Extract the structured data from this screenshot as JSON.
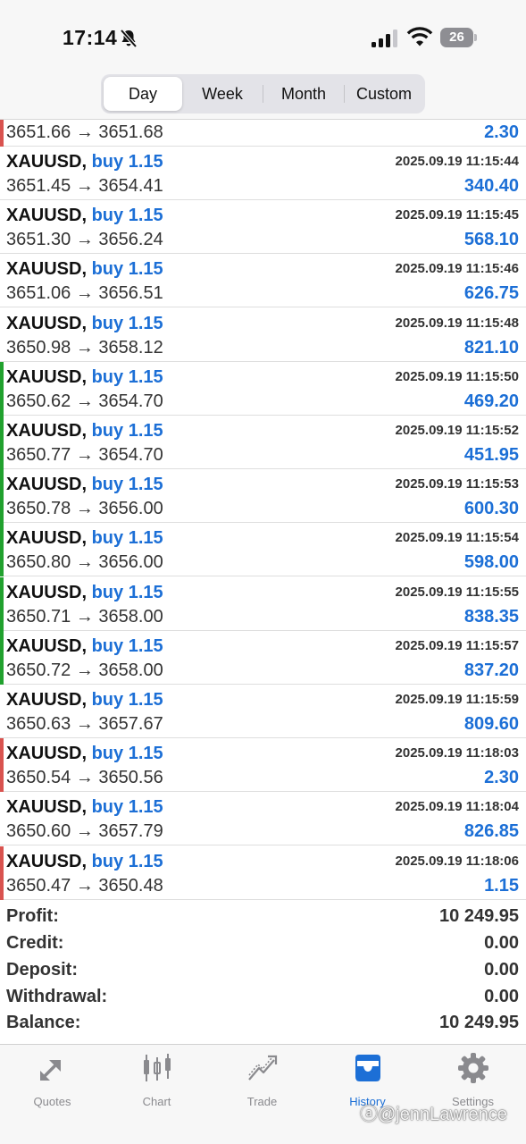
{
  "status_bar": {
    "time": "17:14",
    "battery": "26"
  },
  "segments": [
    {
      "label": "Day",
      "active": true
    },
    {
      "label": "Week",
      "active": false
    },
    {
      "label": "Month",
      "active": false
    },
    {
      "label": "Custom",
      "active": false
    }
  ],
  "partial_deal": {
    "prices": "3651.66 → 3651.68",
    "profit": "2.30",
    "marker": "red"
  },
  "deals": [
    {
      "symbol": "XAUUSD,",
      "type": "buy 1.15",
      "time": "2025.09.19 11:15:44",
      "prices": "3651.45 → 3654.41",
      "profit": "340.40",
      "marker": "none"
    },
    {
      "symbol": "XAUUSD,",
      "type": "buy 1.15",
      "time": "2025.09.19 11:15:45",
      "prices": "3651.30 → 3656.24",
      "profit": "568.10",
      "marker": "none"
    },
    {
      "symbol": "XAUUSD,",
      "type": "buy 1.15",
      "time": "2025.09.19 11:15:46",
      "prices": "3651.06 → 3656.51",
      "profit": "626.75",
      "marker": "none"
    },
    {
      "symbol": "XAUUSD,",
      "type": "buy 1.15",
      "time": "2025.09.19 11:15:48",
      "prices": "3650.98 → 3658.12",
      "profit": "821.10",
      "marker": "none"
    },
    {
      "symbol": "XAUUSD,",
      "type": "buy 1.15",
      "time": "2025.09.19 11:15:50",
      "prices": "3650.62 → 3654.70",
      "profit": "469.20",
      "marker": "green"
    },
    {
      "symbol": "XAUUSD,",
      "type": "buy 1.15",
      "time": "2025.09.19 11:15:52",
      "prices": "3650.77 → 3654.70",
      "profit": "451.95",
      "marker": "green"
    },
    {
      "symbol": "XAUUSD,",
      "type": "buy 1.15",
      "time": "2025.09.19 11:15:53",
      "prices": "3650.78 → 3656.00",
      "profit": "600.30",
      "marker": "green"
    },
    {
      "symbol": "XAUUSD,",
      "type": "buy 1.15",
      "time": "2025.09.19 11:15:54",
      "prices": "3650.80 → 3656.00",
      "profit": "598.00",
      "marker": "green"
    },
    {
      "symbol": "XAUUSD,",
      "type": "buy 1.15",
      "time": "2025.09.19 11:15:55",
      "prices": "3650.71 → 3658.00",
      "profit": "838.35",
      "marker": "green"
    },
    {
      "symbol": "XAUUSD,",
      "type": "buy 1.15",
      "time": "2025.09.19 11:15:57",
      "prices": "3650.72 → 3658.00",
      "profit": "837.20",
      "marker": "green"
    },
    {
      "symbol": "XAUUSD,",
      "type": "buy 1.15",
      "time": "2025.09.19 11:15:59",
      "prices": "3650.63 → 3657.67",
      "profit": "809.60",
      "marker": "none"
    },
    {
      "symbol": "XAUUSD,",
      "type": "buy 1.15",
      "time": "2025.09.19 11:18:03",
      "prices": "3650.54 → 3650.56",
      "profit": "2.30",
      "marker": "red"
    },
    {
      "symbol": "XAUUSD,",
      "type": "buy 1.15",
      "time": "2025.09.19 11:18:04",
      "prices": "3650.60 → 3657.79",
      "profit": "826.85",
      "marker": "none"
    },
    {
      "symbol": "XAUUSD,",
      "type": "buy 1.15",
      "time": "2025.09.19 11:18:06",
      "prices": "3650.47 → 3650.48",
      "profit": "1.15",
      "marker": "red"
    }
  ],
  "summary": [
    {
      "label": "Profit:",
      "value": "10 249.95"
    },
    {
      "label": "Credit:",
      "value": "0.00"
    },
    {
      "label": "Deposit:",
      "value": "0.00"
    },
    {
      "label": "Withdrawal:",
      "value": "0.00"
    },
    {
      "label": "Balance:",
      "value": "10 249.95"
    }
  ],
  "tabs": [
    {
      "label": "Quotes",
      "icon": "quotes-icon",
      "active": false
    },
    {
      "label": "Chart",
      "icon": "chart-icon",
      "active": false
    },
    {
      "label": "Trade",
      "icon": "trade-icon",
      "active": false
    },
    {
      "label": "History",
      "icon": "history-icon",
      "active": true
    },
    {
      "label": "Settings",
      "icon": "settings-icon",
      "active": false
    }
  ],
  "watermark": "@jennLawrence",
  "colors": {
    "accent": "#1c6fd6",
    "loss_marker": "#d9534f",
    "win_marker": "#21a12e"
  }
}
